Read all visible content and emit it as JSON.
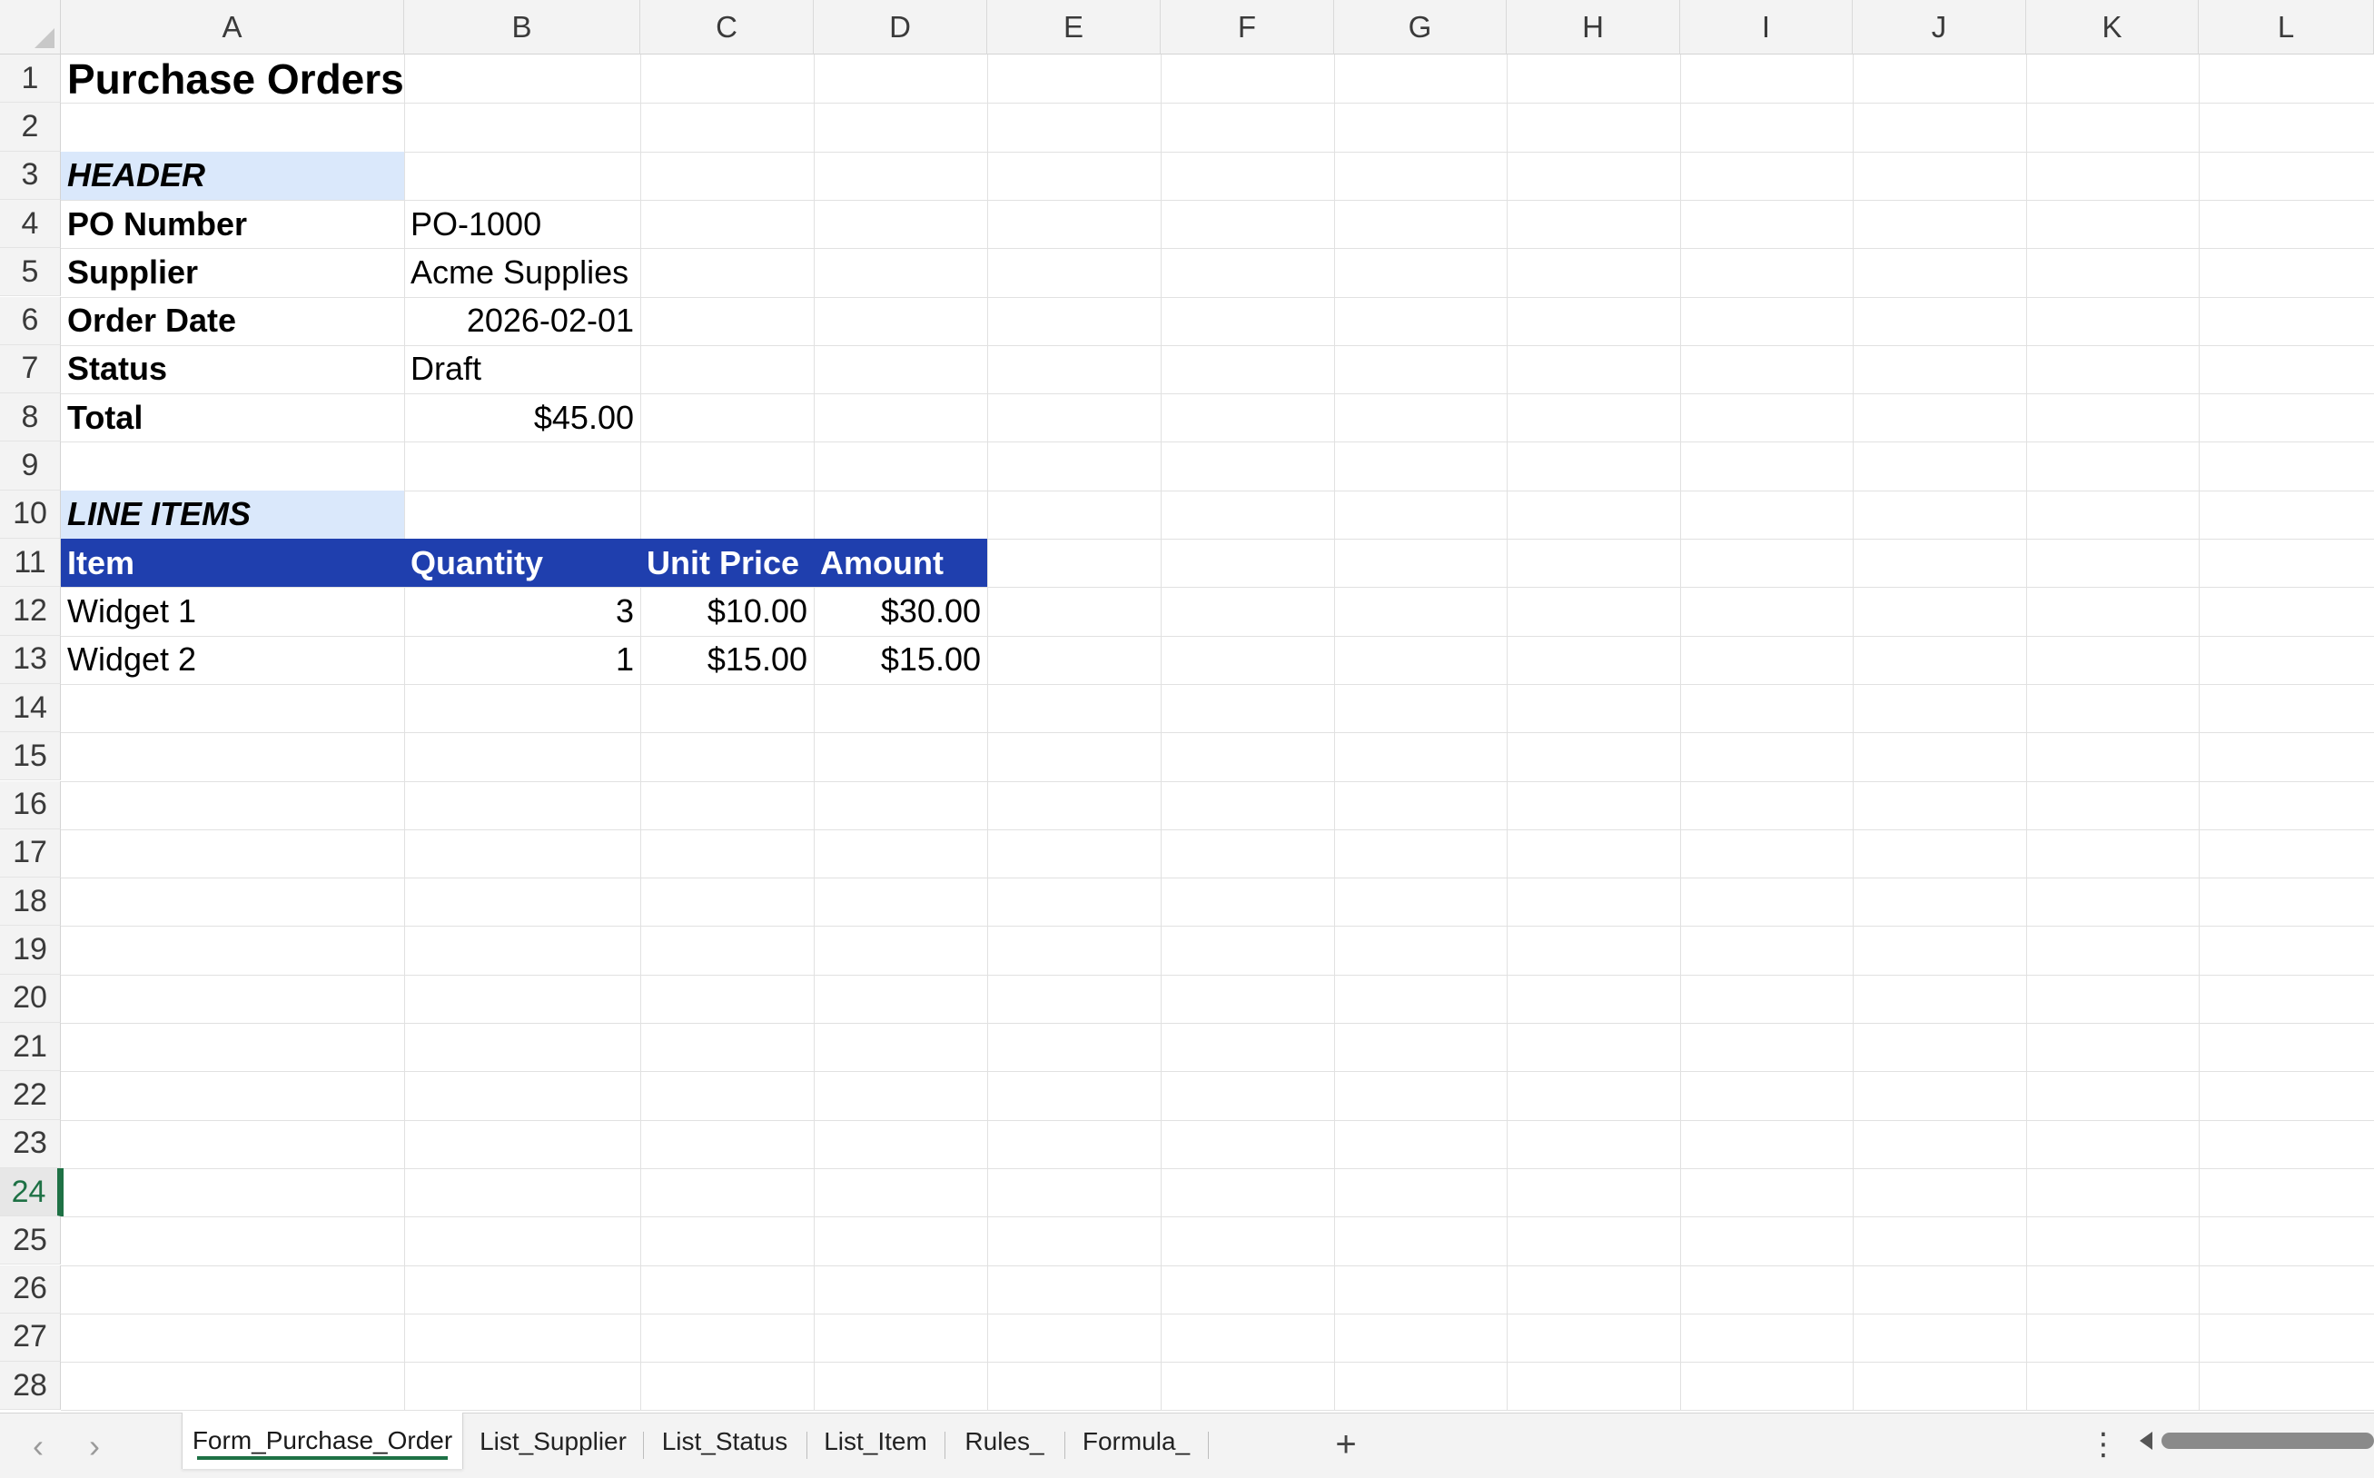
{
  "sheet": {
    "columns": [
      "A",
      "B",
      "C",
      "D",
      "E",
      "F",
      "G",
      "H",
      "I",
      "J",
      "K",
      "L"
    ],
    "rows": [
      "1",
      "2",
      "3",
      "4",
      "5",
      "6",
      "7",
      "8",
      "9",
      "10",
      "11",
      "12",
      "13",
      "14",
      "15",
      "16",
      "17",
      "18",
      "19",
      "20",
      "21",
      "22",
      "23",
      "24",
      "25",
      "26",
      "27",
      "28"
    ],
    "active_row": "24",
    "title": "Purchase Orders",
    "header_section": "HEADER",
    "fields": [
      {
        "label": "PO Number",
        "value": "PO-1000"
      },
      {
        "label": "Supplier",
        "value": "Acme Supplies"
      },
      {
        "label": "Order Date",
        "value": "2026-02-01"
      },
      {
        "label": "Status",
        "value": "Draft"
      },
      {
        "label": "Total",
        "value": "$45.00"
      }
    ],
    "line_items_section": "LINE ITEMS",
    "line_headers": [
      "Item",
      "Quantity",
      "Unit Price",
      "Amount"
    ],
    "line_items": [
      [
        "Widget 1",
        "3",
        "$10.00",
        "$30.00"
      ],
      [
        "Widget 2",
        "1",
        "$15.00",
        "$15.00"
      ]
    ]
  },
  "tabs": [
    "Form_Purchase_Order",
    "List_Supplier",
    "List_Status",
    "List_Item",
    "Rules_",
    "Formula_"
  ],
  "active_tab": "Form_Purchase_Order",
  "icons": {
    "prev_sheet": "chevron-left-icon",
    "next_sheet": "chevron-right-icon",
    "add_sheet": "plus-icon",
    "more": "more-vertical-icon",
    "scroll_left": "triangle-left-icon"
  },
  "colors": {
    "section_fill": "#dae8fb",
    "table_header_fill": "#1f3fae",
    "accent": "#1e7145"
  }
}
